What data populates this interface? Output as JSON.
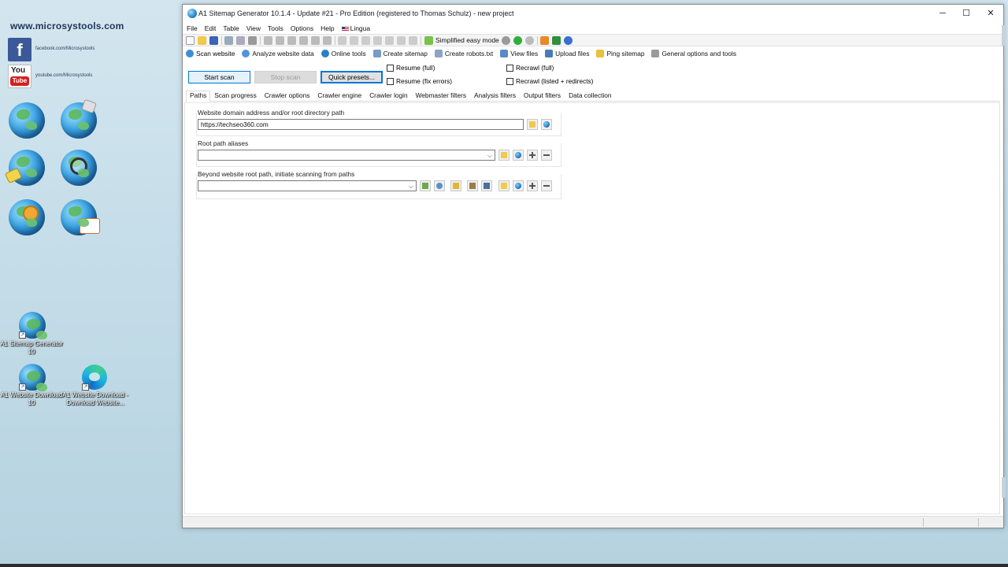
{
  "desktop": {
    "brand": "www.microsystools.com",
    "facebook_link": "facebook.com/Microsystools",
    "youtube_link": "youtube.com/Microsystools",
    "facebook_glyph": "f",
    "youtube_you": "You",
    "youtube_tube": "Tube",
    "shortcuts": [
      {
        "label": "A1 Sitemap Generator 10"
      },
      {
        "label": "A1 Website Download 10"
      },
      {
        "label": "A1 Website Download - Download Website..."
      }
    ]
  },
  "window": {
    "title": "A1 Sitemap Generator 10.1.4 - Update #21 - Pro Edition (registered to Thomas Schulz) - new project",
    "minimize": "─",
    "maximize": "☐",
    "close": "✕"
  },
  "menu": {
    "items": [
      "File",
      "Edit",
      "Table",
      "View",
      "Tools",
      "Options",
      "Help"
    ],
    "lingua": "Lingua"
  },
  "toolbar": {
    "easy_mode": "Simplified easy mode"
  },
  "nav_tabs": [
    "Scan website",
    "Analyze website data",
    "Online tools",
    "Create sitemap",
    "Create robots.txt",
    "View files",
    "Upload files",
    "Ping sitemap",
    "General options and tools"
  ],
  "actions": {
    "start_scan": "Start scan",
    "stop_scan": "Stop scan",
    "quick_presets": "Quick presets...",
    "resume_full": "Resume (full)",
    "resume_fix": "Resume (fix errors)",
    "recrawl_full": "Recrawl (full)",
    "recrawl_listed": "Recrawl (listed + redirects)"
  },
  "sub_tabs": [
    "Paths",
    "Scan progress",
    "Crawler options",
    "Crawler engine",
    "Crawler login",
    "Webmaster filters",
    "Analysis filters",
    "Output filters",
    "Data collection"
  ],
  "paths": {
    "domain_label": "Website domain address and/or root directory path",
    "domain_value": "https://techseo360.com",
    "aliases_label": "Root path aliases",
    "aliases_value": "",
    "beyond_label": "Beyond website root path, initiate scanning from paths",
    "beyond_value": ""
  },
  "colors": {
    "accent": "#0078d7",
    "facebook": "#3b5998",
    "youtube": "#d61f1f"
  }
}
